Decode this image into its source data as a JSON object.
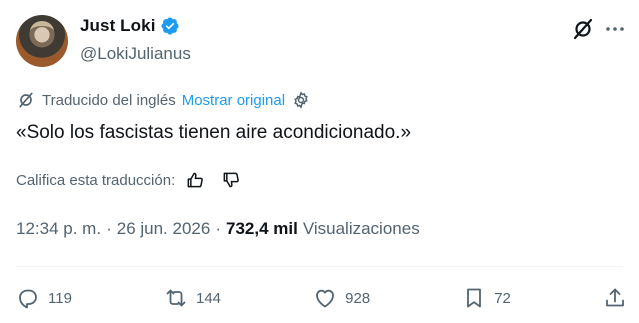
{
  "author": {
    "display_name": "Just Loki",
    "handle": "@LokiJulianus",
    "verified": true
  },
  "translation": {
    "label": "Traducido del inglés",
    "show_original": "Mostrar original"
  },
  "tweet": {
    "text": "«Solo los fascistas tienen aire acondicionado.»"
  },
  "rating": {
    "label": "Califica esta traducción:"
  },
  "meta": {
    "time": "12:34 p. m.",
    "sep1": "·",
    "date": "26 jun. 2026",
    "sep2": "·",
    "views_count": "732,4 mil",
    "views_label": "Visualizaciones"
  },
  "actions": {
    "replies": "119",
    "retweets": "144",
    "likes": "928",
    "bookmarks": "72"
  },
  "colors": {
    "accent": "#1d9bf0",
    "secondary_text": "#536471",
    "primary_text": "#0f1419"
  }
}
